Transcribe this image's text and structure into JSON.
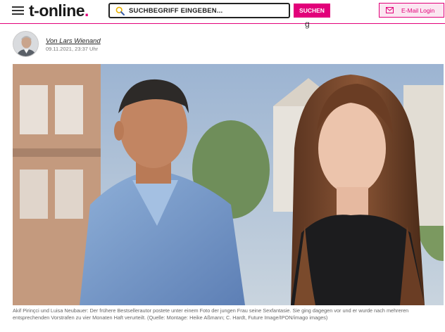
{
  "header": {
    "logo_main": "t-online",
    "logo_dot": ".",
    "search_placeholder": "SUCHBEGRIFF EINGEBEN...",
    "search_button": "SUCHEN",
    "email_login": "E-Mail Login",
    "ghost_text": "g"
  },
  "icons": {
    "menu": "hamburger-menu-icon",
    "search": "magnifier-icon",
    "mail": "envelope-icon"
  },
  "colors": {
    "brand": "#e2007a",
    "text": "#222222",
    "caption": "#666666"
  },
  "article": {
    "author": "Von Lars Wienand",
    "date": "09.11.2021, 23:37 Uhr",
    "caption": "Akif Pirinçci und Luisa Neubauer: Der frühere Bestsellerautor postete unter einem Foto der jungen Frau seine Sexfantasie. Sie ging dagegen vor und er wurde nach mehreren entsprechenden Vorstrafen zu vier Monaten Haft verurteilt. (Quelle: Montage: Heike Aßmann; C. Hardt, Future Image/IPON/imago images)"
  }
}
